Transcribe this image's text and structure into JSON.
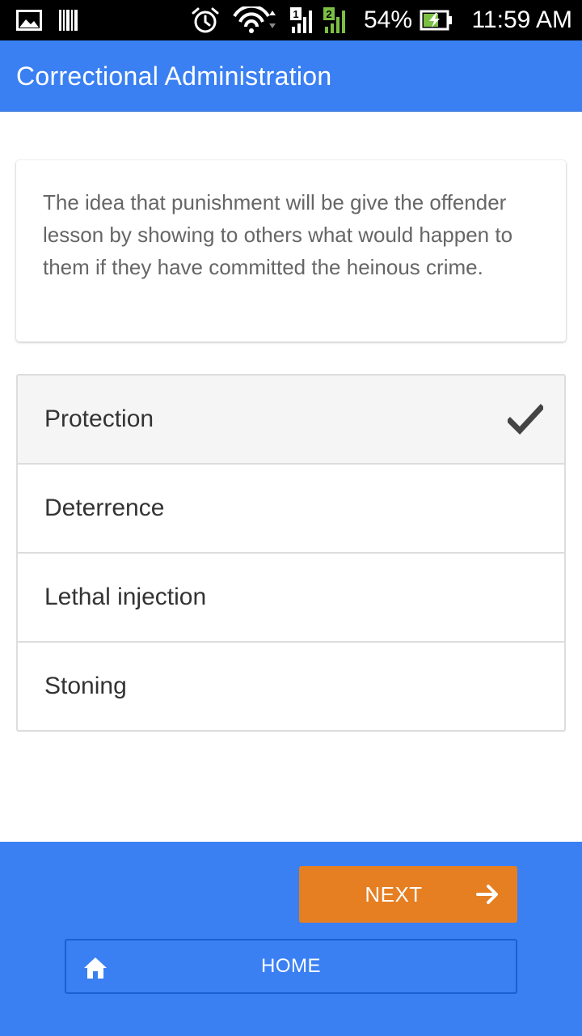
{
  "status_bar": {
    "battery_percent": "54%",
    "time": "11:59 AM",
    "icons": [
      "gallery-icon",
      "barcode-icon",
      "alarm-icon",
      "wifi-icon",
      "signal-sim1-icon",
      "signal-sim2-icon",
      "battery-charging-icon"
    ],
    "sim1_label": "1",
    "sim2_label": "2"
  },
  "app_bar": {
    "title": "Correctional Administration",
    "color": "#3a80f3"
  },
  "question": {
    "text": "The idea that punishment will be give the offender lesson by showing to others what would happen to them if they have committed the heinous crime."
  },
  "answers": [
    {
      "label": "Protection",
      "selected": true,
      "icon": "check-icon"
    },
    {
      "label": "Deterrence",
      "selected": false
    },
    {
      "label": "Lethal injection",
      "selected": false
    },
    {
      "label": "Stoning",
      "selected": false
    }
  ],
  "footer": {
    "next_label": "NEXT",
    "next_icon": "arrow-right-icon",
    "next_color": "#e67e22",
    "home_label": "HOME",
    "home_icon": "home-icon"
  }
}
